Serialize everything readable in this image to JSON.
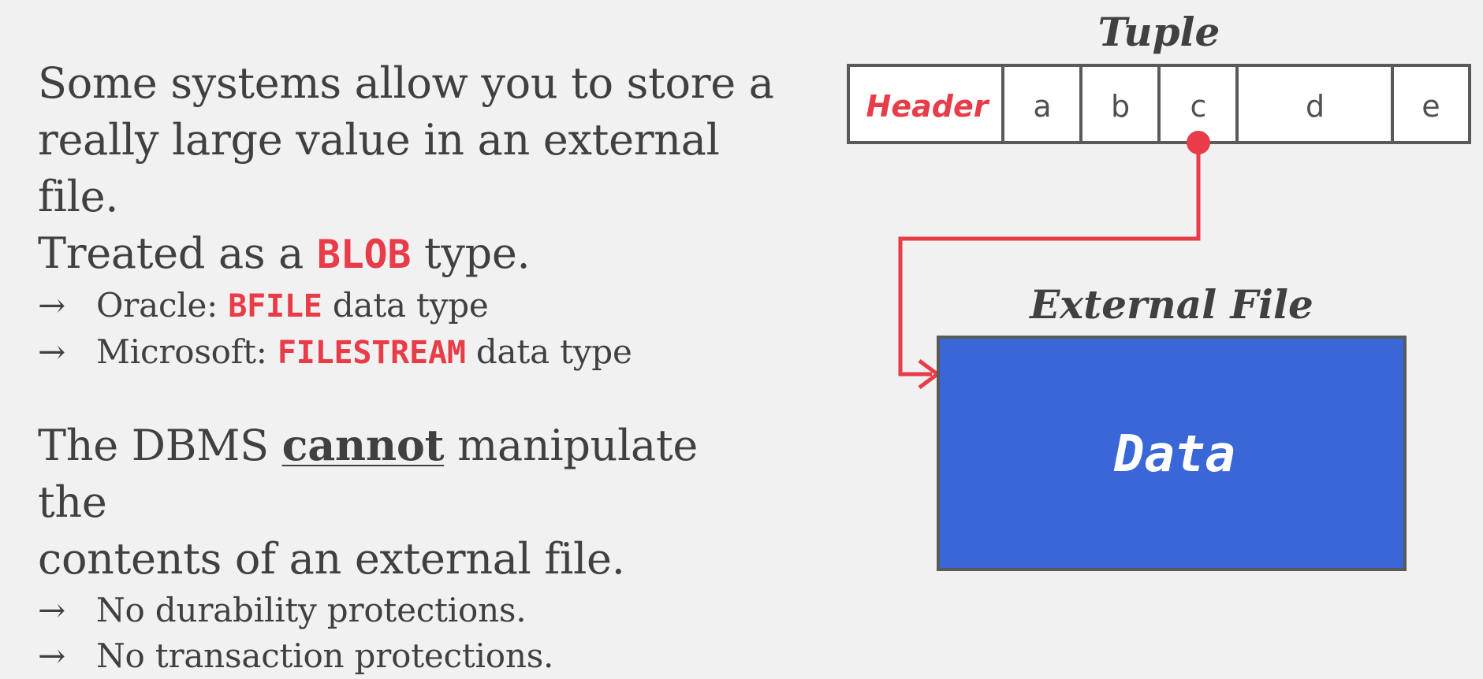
{
  "text_block_1": {
    "lines": [
      "Some systems allow you to store a",
      "really large value in an external file."
    ],
    "line3_before": "Treated as a ",
    "line3_code": "BLOB",
    "line3_after": " type.",
    "bullets": [
      {
        "arrow": "→",
        "before": "Oracle: ",
        "code": "BFILE",
        "after": " data type"
      },
      {
        "arrow": "→",
        "before": "Microsoft: ",
        "code": "FILESTREAM",
        "after": " data type"
      }
    ]
  },
  "text_block_2": {
    "line1_before": "The DBMS ",
    "line1_emph": "cannot",
    "line1_after": " manipulate the",
    "line2": "contents of an external file.",
    "bullets": [
      {
        "arrow": "→",
        "text": "No durability protections."
      },
      {
        "arrow": "→",
        "text": "No transaction protections."
      }
    ]
  },
  "diagram": {
    "tuple_title": "Tuple",
    "tuple_cells": [
      "Header",
      "a",
      "b",
      "c",
      "d",
      "e"
    ],
    "external_title": "External File",
    "data_label": "Data",
    "colors": {
      "accent": "#e83c48",
      "data_box": "#3a67d8",
      "border": "#5a5a5a"
    }
  }
}
